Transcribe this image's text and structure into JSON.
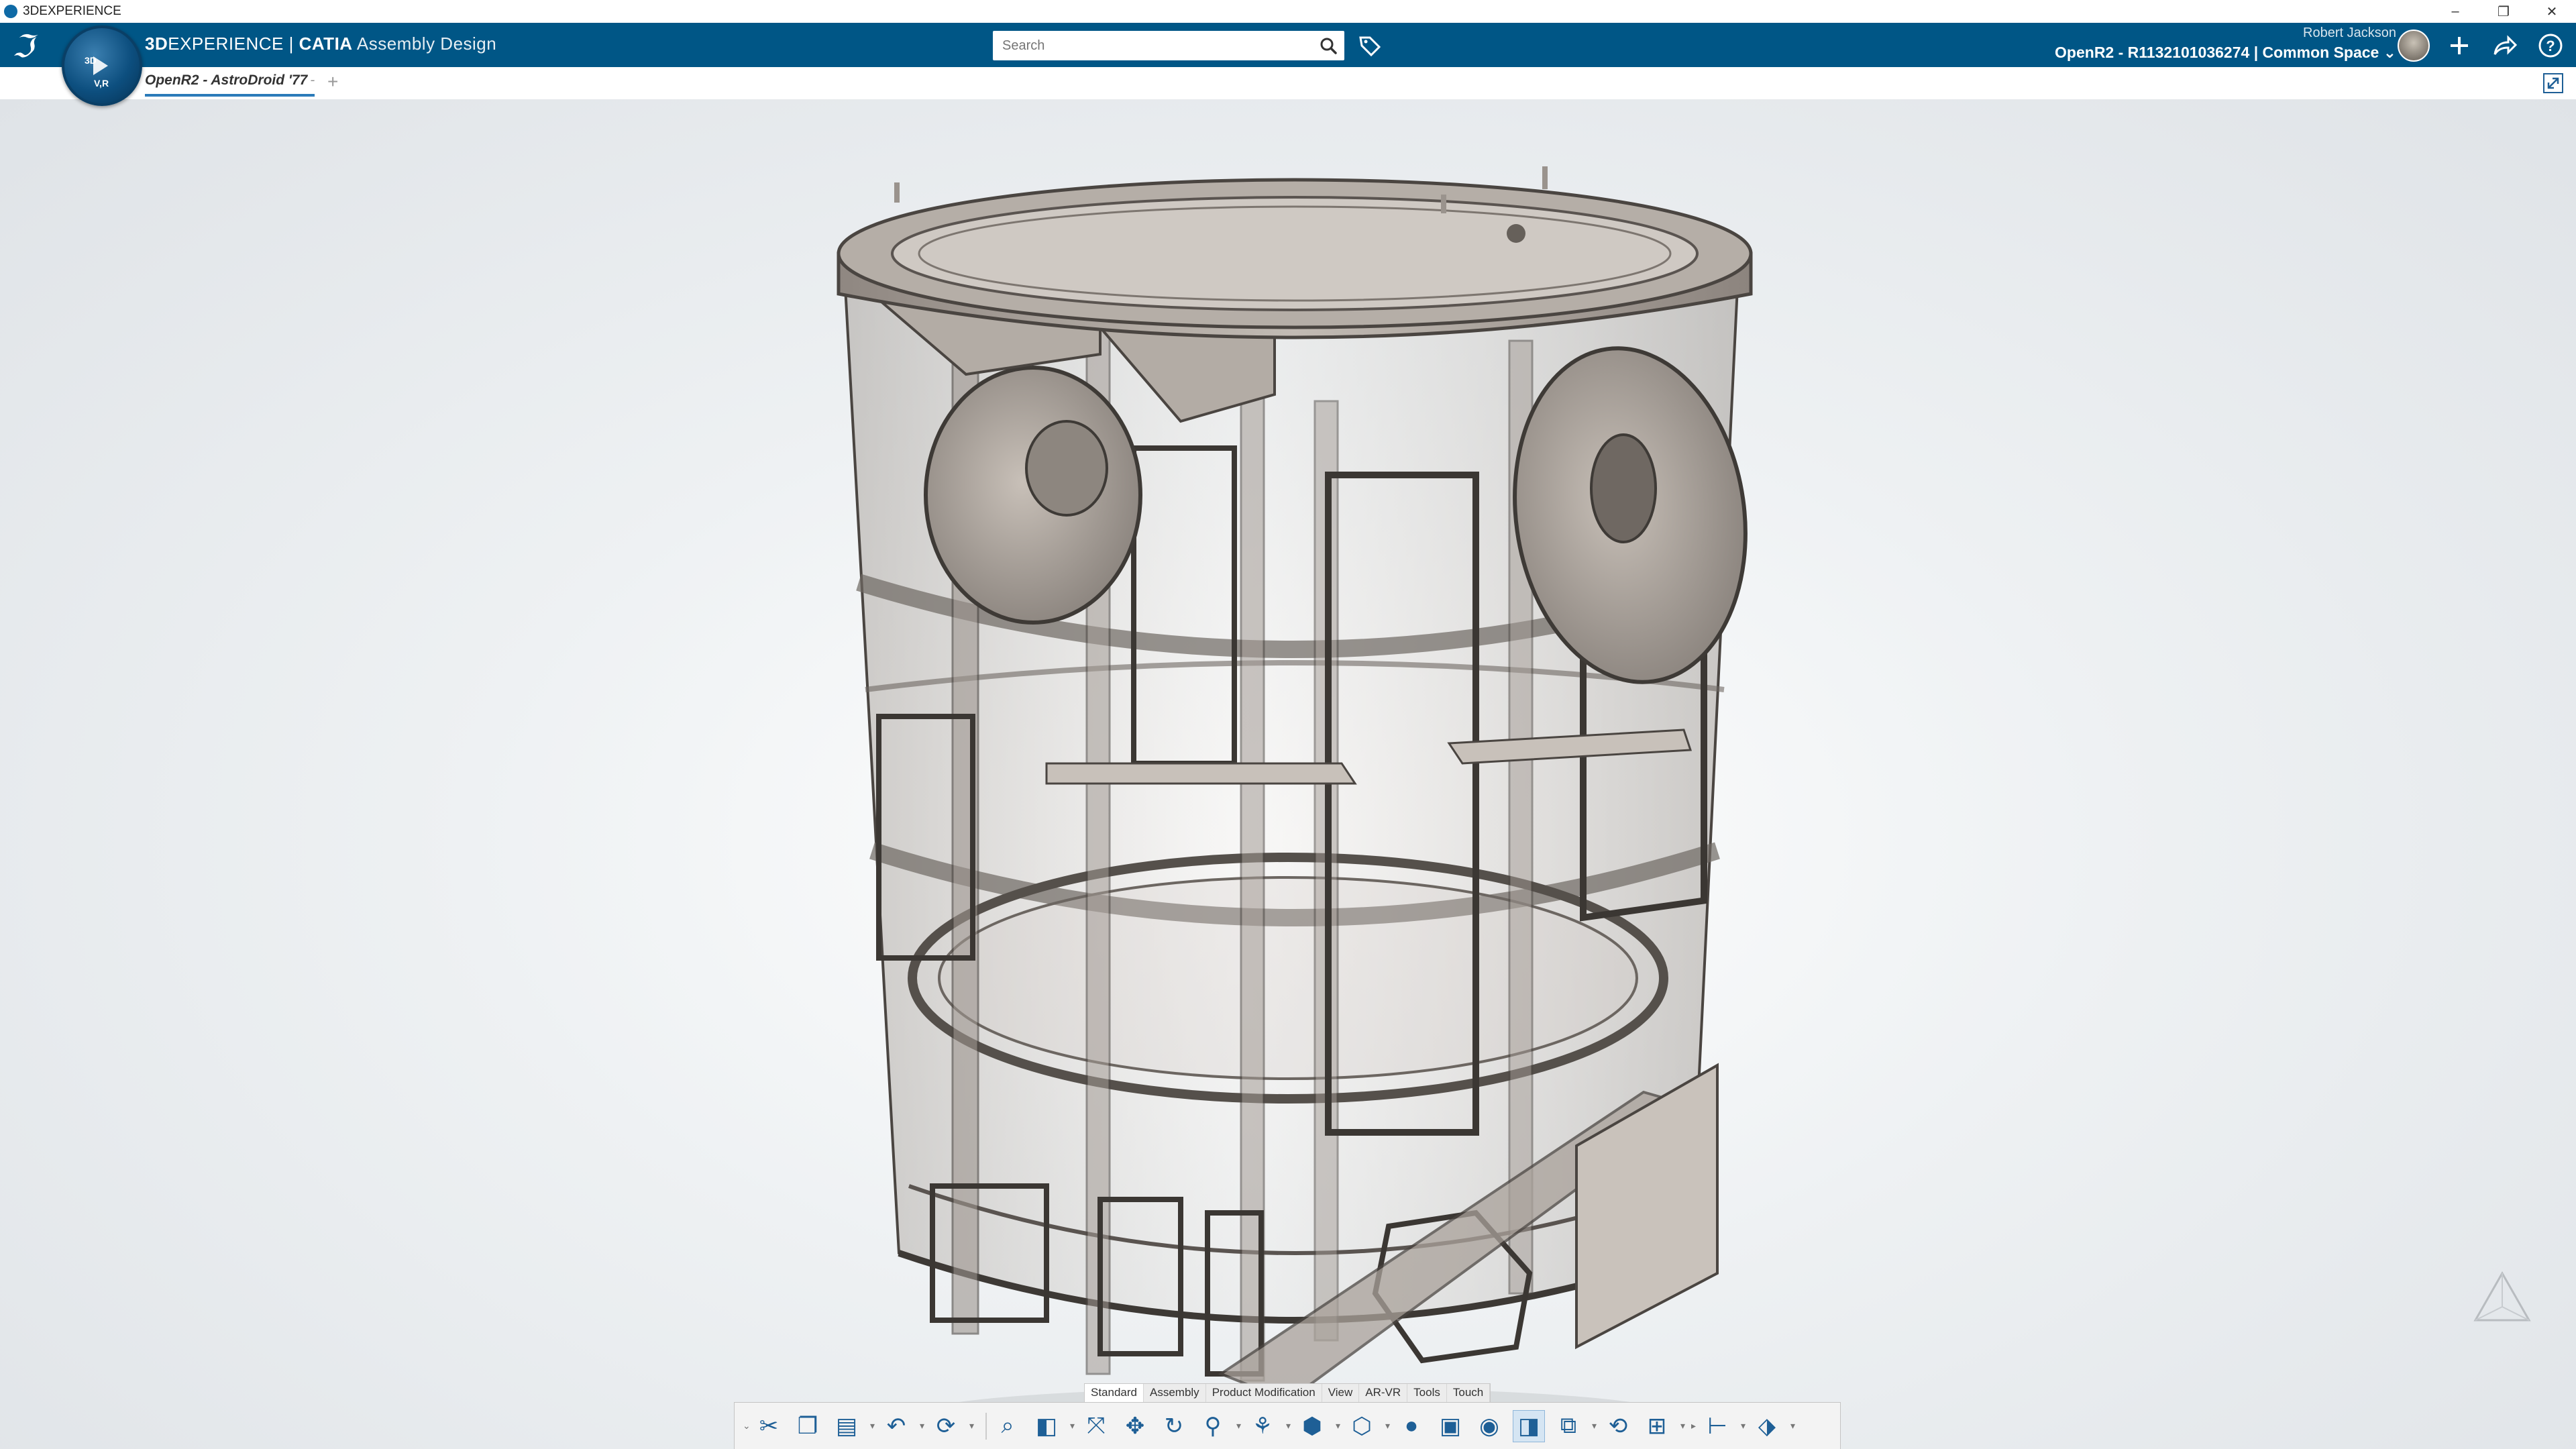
{
  "window": {
    "title": "3DEXPERIENCE",
    "controls": [
      "–",
      "❐",
      "✕"
    ]
  },
  "header": {
    "brand_prefix": "3D",
    "brand_main": "EXPERIENCE",
    "brand_sep": " | ",
    "product": "CATIA",
    "app": " Assembly Design",
    "compass_labels": [
      "3D",
      "V,R"
    ],
    "search_placeholder": "Search",
    "user_name": "Robert Jackson",
    "space": "OpenR2 - R1132101036274 | Common Space",
    "space_caret": "⌄"
  },
  "tabs": [
    {
      "label": "OpenR2 - AstroDroid '77",
      "dash": "-"
    }
  ],
  "tab_add": "+",
  "action_bar": {
    "sections": [
      "Standard",
      "Assembly",
      "Product Modification",
      "View",
      "AR-VR",
      "Tools",
      "Touch"
    ],
    "active_section": "Standard"
  },
  "colors": {
    "header": "#005686",
    "accent": "#2b7bb9",
    "icon": "#1e5f96"
  }
}
